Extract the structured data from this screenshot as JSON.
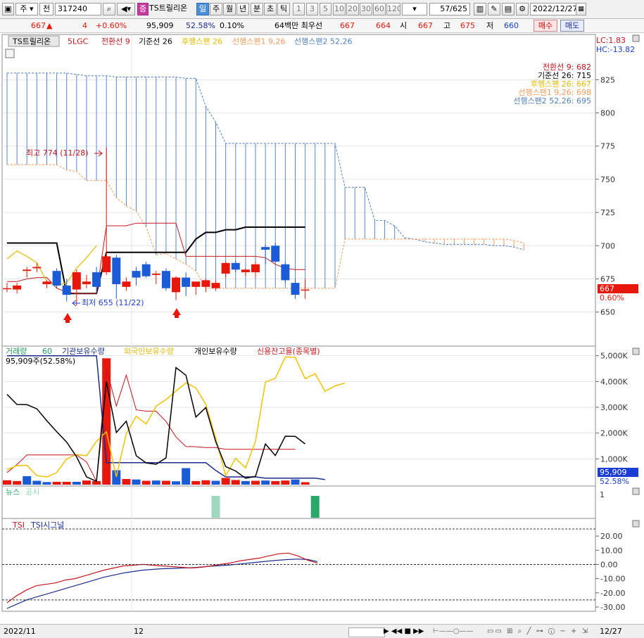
{
  "toolbar": {
    "market": "주",
    "period_type": "전",
    "code": "317240",
    "badge": "증",
    "name": "TS트릴리온",
    "periods": [
      "일",
      "주",
      "월",
      "년",
      "분",
      "초",
      "틱"
    ],
    "active_period": "일",
    "intervals": [
      "1",
      "3",
      "5",
      "10",
      "20",
      "30",
      "60",
      "120"
    ],
    "count": "57",
    "total": "/625",
    "date": "2022/12/27"
  },
  "quote": {
    "price": "667",
    "change": "4",
    "change_pct": "+0.60%",
    "volume": "95,909",
    "turnover_rate": "52.58%",
    "ratio": "0.10%",
    "info": "64백만 최우선",
    "ask": "667",
    "bid": "664",
    "open_label": "시",
    "open": "667",
    "high_label": "고",
    "high": "675",
    "low_label": "저",
    "low": "660",
    "buy_button": "매수",
    "sell_button": "매도"
  },
  "price_panel": {
    "legend": {
      "stock": "TS트릴리온",
      "lgc": "5LGC",
      "conversion": "전환선 9",
      "base": "기준선 26",
      "lagging": "후행스팬 26",
      "lead1": "선행스팬1 9,26",
      "lead2": "선행스팬2 52,26"
    },
    "lc": "LC:1.83",
    "hc": "HC:-13.82",
    "values_box": [
      {
        "label": "전환선 9: 682",
        "color": "#c4161c"
      },
      {
        "label": "기준선 26: 715",
        "color": "#000000"
      },
      {
        "label": "후행스팬 26: 667",
        "color": "#e8b800"
      },
      {
        "label": "선행스팬1 9,26: 698",
        "color": "#f59a5b"
      },
      {
        "label": "선행스팬2 52,26: 695",
        "color": "#4f7fc4"
      }
    ],
    "high_annotation": "최고 774 (11/28)",
    "low_annotation": "최저 655 (11/22)",
    "price_tag": "667",
    "pct_tag": "0.60%",
    "y_ticks": [
      "825",
      "800",
      "775",
      "750",
      "725",
      "700",
      "675",
      "650"
    ]
  },
  "volume_panel": {
    "legend": {
      "volume": "거래량",
      "volume_period": "60",
      "institution": "기관보유수량",
      "foreign": "외국인보유수량",
      "individual": "개인보유수량",
      "credit": "신용잔고율(종목별)"
    },
    "info": "95,909주(52.58%)",
    "y_ticks": [
      "5,000K",
      "4,000K",
      "3,000K",
      "2,000K",
      "1,000K"
    ],
    "tag_volume": "95,909",
    "tag_pct": "52.58%"
  },
  "news_panel": {
    "news_label": "뉴스",
    "notice_label": "공시",
    "axis_label": "1"
  },
  "tsi_panel": {
    "tsi_label": "TSI",
    "signal_label": "TSI시그널",
    "y_ticks": [
      "20.00",
      "10.00",
      "0.00",
      "-10.00",
      "-20.00",
      "-30.00"
    ]
  },
  "x_axis": {
    "labels": [
      "2022/11",
      "12"
    ],
    "last_label": "12/27"
  },
  "chart_data": {
    "type": "candlestick",
    "price_range": [
      635,
      840
    ],
    "candles": [
      {
        "o": 668,
        "h": 672,
        "l": 665,
        "c": 668
      },
      {
        "o": 667,
        "h": 672,
        "l": 664,
        "c": 670
      },
      {
        "o": 681,
        "h": 684,
        "l": 676,
        "c": 682
      },
      {
        "o": 683,
        "h": 687,
        "l": 680,
        "c": 684
      },
      {
        "o": 671,
        "h": 674,
        "l": 668,
        "c": 673
      },
      {
        "o": 681,
        "h": 683,
        "l": 668,
        "c": 670
      },
      {
        "o": 670,
        "h": 675,
        "l": 658,
        "c": 663
      },
      {
        "o": 667,
        "h": 682,
        "l": 655,
        "c": 680
      },
      {
        "o": 671,
        "h": 678,
        "l": 668,
        "c": 673
      },
      {
        "o": 680,
        "h": 684,
        "l": 665,
        "c": 669
      },
      {
        "o": 680,
        "h": 774,
        "l": 678,
        "c": 692
      },
      {
        "o": 691,
        "h": 693,
        "l": 660,
        "c": 671
      },
      {
        "o": 669,
        "h": 676,
        "l": 666,
        "c": 673
      },
      {
        "o": 681,
        "h": 684,
        "l": 670,
        "c": 676
      },
      {
        "o": 686,
        "h": 688,
        "l": 676,
        "c": 677
      },
      {
        "o": 678,
        "h": 681,
        "l": 671,
        "c": 679
      },
      {
        "o": 681,
        "h": 683,
        "l": 666,
        "c": 668
      },
      {
        "o": 665,
        "h": 677,
        "l": 659,
        "c": 676
      },
      {
        "o": 676,
        "h": 680,
        "l": 662,
        "c": 669
      },
      {
        "o": 669,
        "h": 672,
        "l": 663,
        "c": 673
      },
      {
        "o": 669,
        "h": 675,
        "l": 665,
        "c": 674
      },
      {
        "o": 668,
        "h": 674,
        "l": 666,
        "c": 672
      },
      {
        "o": 679,
        "h": 688,
        "l": 676,
        "c": 687
      },
      {
        "o": 687,
        "h": 689,
        "l": 680,
        "c": 682
      },
      {
        "o": 680,
        "h": 683,
        "l": 677,
        "c": 682
      },
      {
        "o": 680,
        "h": 688,
        "l": 676,
        "c": 686
      },
      {
        "o": 699,
        "h": 701,
        "l": 686,
        "c": 697
      },
      {
        "o": 700,
        "h": 702,
        "l": 687,
        "c": 688
      },
      {
        "o": 686,
        "h": 688,
        "l": 672,
        "c": 674
      },
      {
        "o": 672,
        "h": 675,
        "l": 660,
        "c": 663
      },
      {
        "o": 667,
        "h": 675,
        "l": 660,
        "c": 667
      }
    ],
    "conversion_line": [
      673,
      673,
      675,
      676,
      676,
      668,
      665,
      664,
      664,
      664,
      715,
      715,
      715,
      717,
      717,
      717,
      717,
      717,
      692,
      692,
      692,
      692,
      692,
      692,
      692,
      692,
      691,
      686,
      683,
      682,
      682
    ],
    "base_line": [
      702,
      702,
      702,
      702,
      702,
      702,
      664,
      664,
      664,
      664,
      695,
      695,
      695,
      695,
      695,
      695,
      695,
      695,
      695,
      705,
      710,
      710,
      712,
      712,
      714,
      714,
      714,
      714,
      714,
      714,
      714
    ],
    "lagging_span": [
      690,
      696,
      692,
      687,
      673,
      670,
      672,
      683,
      691,
      700
    ],
    "lead_span1": [
      761,
      761,
      761,
      761,
      761,
      761,
      757,
      756,
      749,
      749,
      749,
      736,
      730,
      726,
      714,
      693,
      694,
      690,
      686,
      681,
      668,
      668,
      668,
      668,
      668,
      668,
      668,
      668,
      668,
      668,
      668,
      668,
      668,
      668,
      705,
      705,
      705,
      705,
      705,
      705,
      705,
      705,
      705,
      705,
      705,
      705,
      705,
      705,
      705,
      705,
      705,
      704,
      702
    ],
    "lead_span2": [
      830,
      830,
      830,
      830,
      830,
      830,
      830,
      829,
      828,
      828,
      828,
      827,
      827,
      827,
      827,
      827,
      827,
      827,
      826,
      826,
      805,
      793,
      777,
      777,
      777,
      777,
      777,
      777,
      777,
      777,
      777,
      777,
      777,
      777,
      744,
      744,
      744,
      719,
      719,
      715,
      706,
      705,
      703,
      702,
      701,
      701,
      701,
      701,
      701,
      700,
      700,
      699,
      697
    ],
    "volume_bars_k": [
      170,
      140,
      330,
      150,
      100,
      110,
      110,
      110,
      160,
      140,
      4900,
      560,
      220,
      200,
      150,
      160,
      150,
      130,
      640,
      140,
      170,
      150,
      260,
      180,
      140,
      150,
      160,
      140,
      160,
      200,
      95.909
    ],
    "volume_up": [
      true,
      true,
      false,
      false,
      false,
      true,
      true,
      false,
      true,
      true,
      true,
      false,
      true,
      false,
      true,
      false,
      true,
      false,
      false,
      true,
      true,
      false,
      true,
      true,
      false,
      true,
      false,
      true,
      true,
      false,
      true
    ],
    "institution_k": [
      5000,
      5000,
      5000,
      5000,
      5000,
      5000,
      5000,
      5000,
      5000,
      5000,
      850,
      850,
      850,
      850,
      850,
      850,
      850,
      850,
      850,
      850,
      850,
      550,
      300,
      300,
      300,
      300,
      250,
      250,
      250,
      250,
      250,
      250,
      200
    ],
    "foreign_k": [
      580,
      740,
      750,
      350,
      300,
      470,
      1000,
      1170,
      1120,
      1680,
      2050,
      300,
      1980,
      2650,
      2350,
      3040,
      3300,
      3630,
      3950,
      3750,
      3120,
      1800,
      350,
      1020,
      650,
      1680,
      3980,
      4120,
      4950,
      4930,
      4110,
      4300,
      3620,
      3830,
      3940
    ],
    "individual_k": [
      3500,
      3110,
      3100,
      2940,
      2480,
      2050,
      1650,
      1080,
      300,
      130,
      3990,
      2020,
      2460,
      1120,
      840,
      790,
      1040,
      4540,
      4240,
      2620,
      2990,
      1670,
      700,
      530,
      250,
      320,
      1580,
      1130,
      1880,
      1870,
      1580
    ],
    "credit_ratio_k": [
      470,
      780,
      1150,
      1150,
      1150,
      1150,
      1150,
      1150,
      880,
      130,
      4500,
      3050,
      4250,
      2900,
      2850,
      2850,
      2450,
      1850,
      1480,
      1470,
      1440,
      1440,
      1370,
      1370,
      1370,
      1370,
      1370,
      1370,
      1370,
      1370
    ],
    "vol_range": [
      0,
      5100
    ],
    "news_marks": [
      21,
      31
    ],
    "tsi": [
      -27,
      -22,
      -18,
      -15,
      -14,
      -13,
      -11,
      -10,
      -8,
      -6,
      -4,
      -2.5,
      -1,
      -0.5,
      0,
      -0.5,
      -1,
      -1.5,
      -2,
      -2.5,
      -2,
      -1,
      0,
      1,
      2.5,
      3.5,
      4.5,
      6,
      7.5,
      8,
      6,
      3,
      1
    ],
    "tsi_signal": [
      -31,
      -28,
      -25,
      -23,
      -21,
      -19,
      -17,
      -15,
      -13,
      -11,
      -9,
      -7.5,
      -6,
      -5,
      -4,
      -3.5,
      -3,
      -2.8,
      -2.5,
      -2.3,
      -1.8,
      -1.2,
      -0.8,
      -0.3,
      0.3,
      1,
      1.7,
      2.4,
      3,
      3.5,
      3.8,
      3.5,
      2
    ],
    "tsi_range": [
      -32,
      26
    ]
  }
}
